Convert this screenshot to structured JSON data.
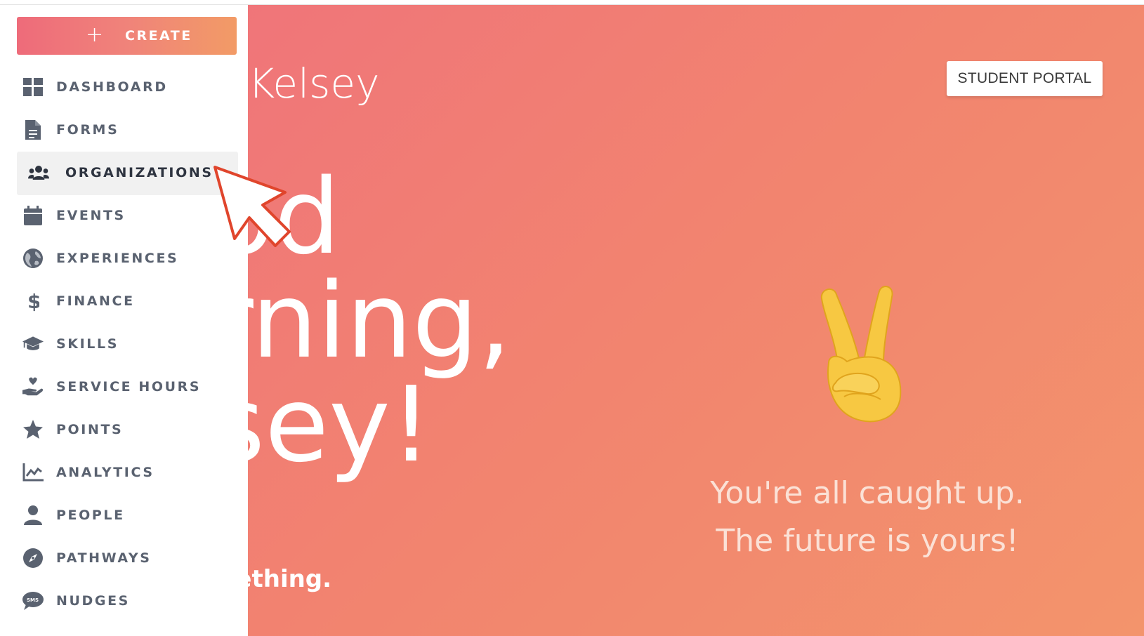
{
  "header": {
    "greeting_partial": "g Kelsey",
    "student_portal_label": "STUDENT PORTAL"
  },
  "hero": {
    "line1": "od",
    "line2": "rning,",
    "line3": "sey!",
    "subtext": "mething."
  },
  "status": {
    "emoji": "✌️",
    "line1": "You're all caught up.",
    "line2": "The future is yours!"
  },
  "sidebar": {
    "create_label": "CREATE",
    "create_icon": "+",
    "items": [
      {
        "label": "DASHBOARD",
        "icon": "dashboard-icon"
      },
      {
        "label": "FORMS",
        "icon": "file-icon"
      },
      {
        "label": "ORGANIZATIONS",
        "icon": "users-icon",
        "active": true
      },
      {
        "label": "EVENTS",
        "icon": "calendar-icon"
      },
      {
        "label": "EXPERIENCES",
        "icon": "globe-icon"
      },
      {
        "label": "FINANCE",
        "icon": "dollar-icon"
      },
      {
        "label": "SKILLS",
        "icon": "graduation-cap-icon"
      },
      {
        "label": "SERVICE HOURS",
        "icon": "hand-heart-icon"
      },
      {
        "label": "POINTS",
        "icon": "star-icon"
      },
      {
        "label": "ANALYTICS",
        "icon": "line-chart-icon"
      },
      {
        "label": "PEOPLE",
        "icon": "user-icon"
      },
      {
        "label": "PATHWAYS",
        "icon": "compass-icon"
      },
      {
        "label": "NUDGES",
        "icon": "sms-bubble-icon"
      }
    ]
  },
  "colors": {
    "gradient_start": "#ef707d",
    "gradient_end": "#f3946c",
    "nav_text": "#5a6270",
    "nav_text_active": "#2e3440",
    "active_bg": "#f1f1f1",
    "cursor_outline": "#e0452c"
  }
}
